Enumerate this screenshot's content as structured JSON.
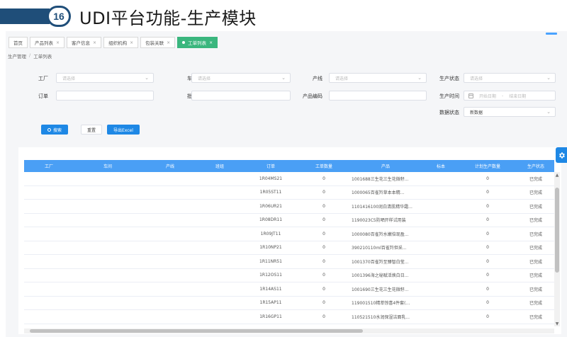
{
  "slide": {
    "number": "16",
    "title": "UDI平台功能-生产模块"
  },
  "tabs": [
    {
      "label": "首页",
      "closable": false,
      "active": false
    },
    {
      "label": "产品列表",
      "closable": true,
      "active": false
    },
    {
      "label": "客户信息",
      "closable": true,
      "active": false
    },
    {
      "label": "组织机构",
      "closable": true,
      "active": false
    },
    {
      "label": "包装关联",
      "closable": true,
      "active": false
    },
    {
      "label": "工单列表",
      "closable": true,
      "active": true
    }
  ],
  "close_glyph": "×",
  "breadcrumb": {
    "parent": "生产管理",
    "separator": "/",
    "current": "工单列表"
  },
  "filters": {
    "factory": {
      "label": "工厂",
      "placeholder": "请选择"
    },
    "workshop": {
      "label": "车间",
      "placeholder": "请选择"
    },
    "line": {
      "label": "产线",
      "placeholder": "请选择"
    },
    "prod_status": {
      "label": "生产状态",
      "placeholder": "请选择"
    },
    "order": {
      "label": "订单",
      "value": ""
    },
    "batch": {
      "label": "批次",
      "value": ""
    },
    "product_code": {
      "label": "产品编码",
      "value": ""
    },
    "prod_time": {
      "label": "生产时间",
      "start_placeholder": "开始日期",
      "end_placeholder": "结束日期",
      "separator": "-"
    },
    "data_status": {
      "label": "数据状态",
      "value": "新数据"
    }
  },
  "buttons": {
    "search": "搜索",
    "reset": "重置",
    "export": "导出Excel"
  },
  "table": {
    "headers": [
      "工厂",
      "车间",
      "产线",
      "班组",
      "订单",
      "工单数量",
      "产品",
      "标本",
      "计划生产数量",
      "生产状态"
    ],
    "rows": [
      {
        "order": "1R04MS21",
        "qty": "0",
        "product": "1001688三生花三生花微籽...",
        "planned": "0",
        "status": "已完成"
      },
      {
        "order": "1R05ST11",
        "qty": "0",
        "product": "1000065百雀羚草本本精...",
        "planned": "0",
        "status": "已完成"
      },
      {
        "order": "1R06UR21",
        "qty": "0",
        "product": "1101416100润白清肌精华霜...",
        "planned": "0",
        "status": "已完成"
      },
      {
        "order": "1R08DR11",
        "qty": "0",
        "product": "1190023C5防晒开样试用装",
        "planned": "0",
        "status": "已完成"
      },
      {
        "order": "1R09JT11",
        "qty": "0",
        "product": "1000080百雀羚水嫩倍现盈...",
        "planned": "0",
        "status": "已完成"
      },
      {
        "order": "1R10NP21",
        "qty": "0",
        "product": "390210110ml百雀羚但采...",
        "planned": "0",
        "status": "已完成"
      },
      {
        "order": "1R11NR51",
        "qty": "0",
        "product": "1001370百雀羚至臻智白莹...",
        "planned": "0",
        "status": "已完成"
      },
      {
        "order": "1R12OS11",
        "qty": "0",
        "product": "1001396海之秘赋活焕白日...",
        "planned": "0",
        "status": "已完成"
      },
      {
        "order": "1R14AS11",
        "qty": "0",
        "product": "1001690三生花三生花微籽...",
        "planned": "0",
        "status": "已完成"
      },
      {
        "order": "1R15AP11",
        "qty": "0",
        "product": "119001510精萃惊喜4件套(...",
        "planned": "0",
        "status": "已完成"
      },
      {
        "order": "1R16GP11",
        "qty": "0",
        "product": "110521510水润保湿洁面乳...",
        "planned": "0",
        "status": "已完成"
      }
    ]
  },
  "icons": {
    "search": "search-icon",
    "settings": "gear-icon",
    "calendar": "calendar-icon",
    "chevron": "chevron-down-icon"
  },
  "colors": {
    "accent": "#1e88e5",
    "header_blue": "#4a9ff5",
    "active_tab": "#3ab67e",
    "slide_band": "#1f4e79"
  }
}
